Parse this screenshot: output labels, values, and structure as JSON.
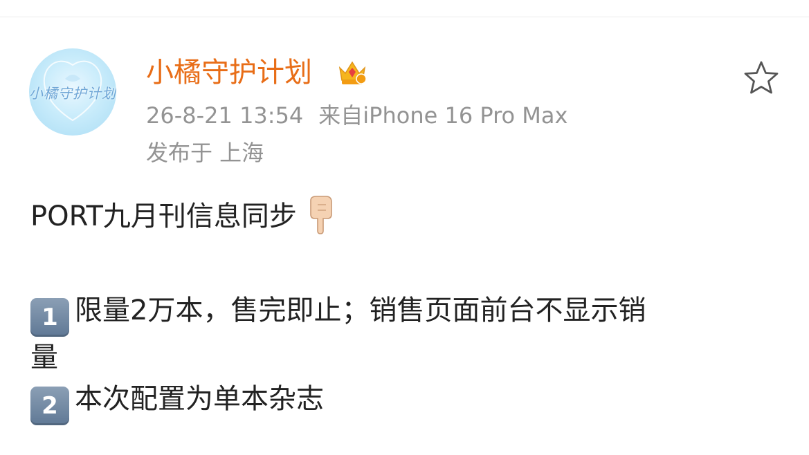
{
  "post": {
    "author": {
      "name": "小橘守护计划",
      "avatar_text": "小橘守护计划",
      "badge_icon": "crown-icon"
    },
    "timestamp": "26-8-21 13:54",
    "source": "来自iPhone 16 Pro Max",
    "location": "发布于 上海",
    "favorite_icon": "star-outline-icon",
    "content": {
      "title": "PORT九月刊信息同步",
      "title_emoji": "pointing-down-hand-icon",
      "items": [
        {
          "number": "1",
          "text_line1": "限量2万本，售完即止；销售页面前台不显示销",
          "text_line2": "量"
        },
        {
          "number": "2",
          "text_line1": "本次配置为单本杂志"
        }
      ]
    }
  },
  "colors": {
    "username": "#e86d17",
    "meta": "#939393",
    "body_text": "#222222",
    "keycap": "#6f87a3"
  }
}
